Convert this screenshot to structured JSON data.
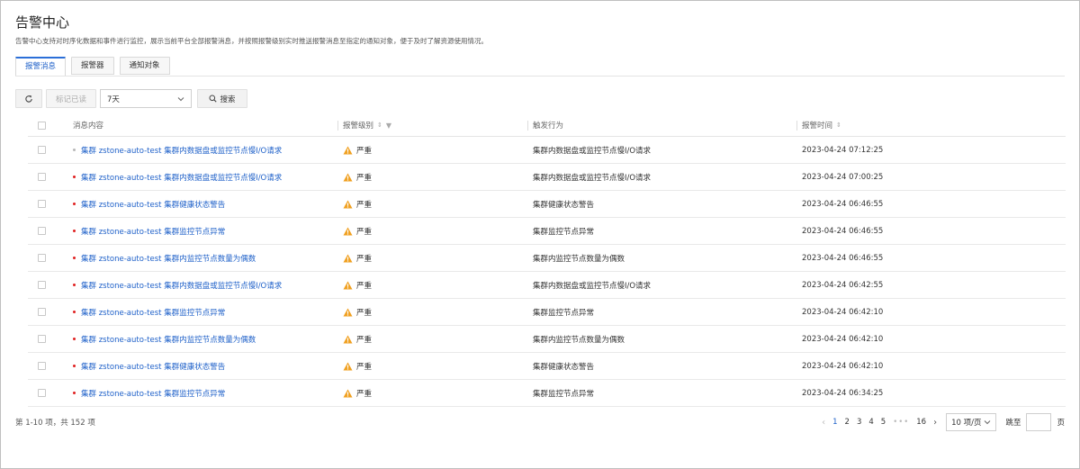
{
  "header": {
    "title": "告警中心",
    "description": "告警中心支持对时序化数据和事件进行监控，展示当前平台全部报警消息，并按照报警级别实时推送报警消息至指定的通知对象，便于及时了解资源使用情况。"
  },
  "tabs": [
    {
      "label": "报警消息",
      "active": true
    },
    {
      "label": "报警器",
      "active": false
    },
    {
      "label": "通知对象",
      "active": false
    }
  ],
  "toolbar": {
    "refresh_icon": "refresh-icon",
    "mark_read_label": "标记已读",
    "time_range_value": "7天",
    "search_label": "搜索"
  },
  "table": {
    "columns": {
      "message": "消息内容",
      "level": "报警级别",
      "action": "触发行为",
      "time": "报警时间"
    },
    "rows": [
      {
        "dot": "grey",
        "message": "集群 zstone-auto-test 集群内数据盘或监控节点慢I/O请求",
        "level": "严重",
        "action": "集群内数据盘或监控节点慢I/O请求",
        "time": "2023-04-24 07:12:25"
      },
      {
        "dot": "red",
        "message": "集群 zstone-auto-test 集群内数据盘或监控节点慢I/O请求",
        "level": "严重",
        "action": "集群内数据盘或监控节点慢I/O请求",
        "time": "2023-04-24 07:00:25"
      },
      {
        "dot": "red",
        "message": "集群 zstone-auto-test 集群健康状态警告",
        "level": "严重",
        "action": "集群健康状态警告",
        "time": "2023-04-24 06:46:55"
      },
      {
        "dot": "red",
        "message": "集群 zstone-auto-test 集群监控节点异常",
        "level": "严重",
        "action": "集群监控节点异常",
        "time": "2023-04-24 06:46:55"
      },
      {
        "dot": "red",
        "message": "集群 zstone-auto-test 集群内监控节点数量为偶数",
        "level": "严重",
        "action": "集群内监控节点数量为偶数",
        "time": "2023-04-24 06:46:55"
      },
      {
        "dot": "red",
        "message": "集群 zstone-auto-test 集群内数据盘或监控节点慢I/O请求",
        "level": "严重",
        "action": "集群内数据盘或监控节点慢I/O请求",
        "time": "2023-04-24 06:42:55"
      },
      {
        "dot": "red",
        "message": "集群 zstone-auto-test 集群监控节点异常",
        "level": "严重",
        "action": "集群监控节点异常",
        "time": "2023-04-24 06:42:10"
      },
      {
        "dot": "red",
        "message": "集群 zstone-auto-test 集群内监控节点数量为偶数",
        "level": "严重",
        "action": "集群内监控节点数量为偶数",
        "time": "2023-04-24 06:42:10"
      },
      {
        "dot": "red",
        "message": "集群 zstone-auto-test 集群健康状态警告",
        "level": "严重",
        "action": "集群健康状态警告",
        "time": "2023-04-24 06:42:10"
      },
      {
        "dot": "red",
        "message": "集群 zstone-auto-test 集群监控节点异常",
        "level": "严重",
        "action": "集群监控节点异常",
        "time": "2023-04-24 06:34:25"
      }
    ]
  },
  "footer": {
    "total": "第 1-10 项，共 152 项",
    "pages": [
      "1",
      "2",
      "3",
      "4",
      "5"
    ],
    "more": "•••",
    "last_page": "16",
    "page_size": "10 项/页",
    "jump_label": "跳至",
    "page_unit": "页"
  },
  "colors": {
    "link": "#1f61c9",
    "dot_red": "#e02020",
    "dot_grey": "#b8b8b8",
    "warning": "#f0a020"
  }
}
